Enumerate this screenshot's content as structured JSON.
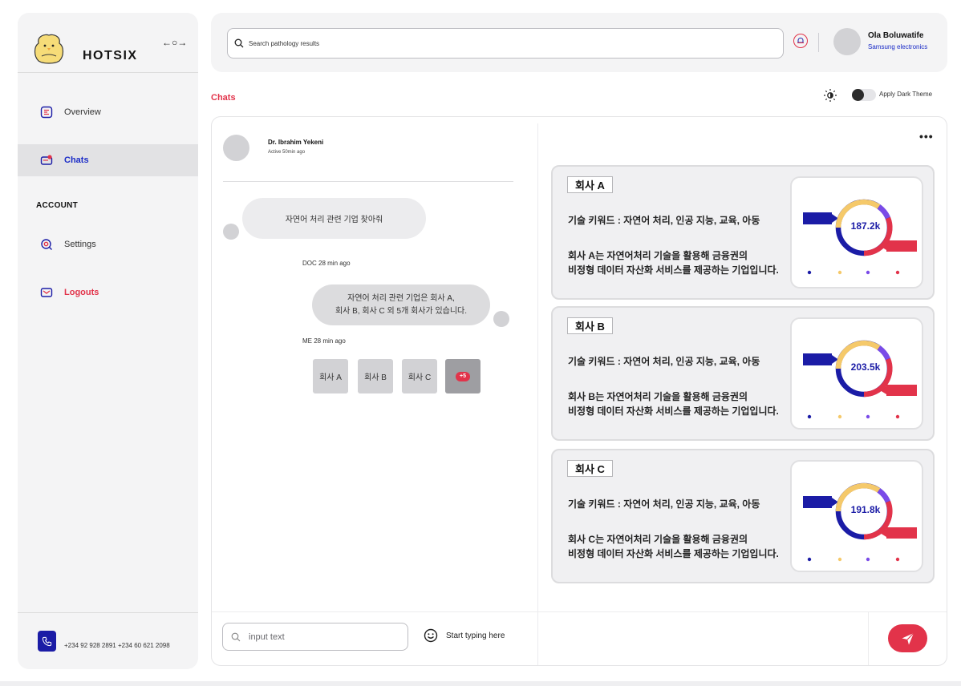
{
  "app": {
    "brand": "HOTSIX"
  },
  "sidebar": {
    "items": [
      {
        "label": "Overview"
      },
      {
        "label": "Chats"
      }
    ],
    "section_title": "ACCOUNT",
    "account_items": [
      {
        "label": "Settings"
      },
      {
        "label": "Logouts"
      }
    ],
    "contact_phones": "+234 92 928 2891  +234 60 621 2098"
  },
  "topbar": {
    "search_placeholder": "Search pathology results",
    "user_name": "Ola Boluwatife",
    "user_company": "Samsung electronics"
  },
  "page": {
    "title": "Chats",
    "dark_theme_label": "Apply Dark Theme",
    "dark_theme_on": false
  },
  "chat": {
    "contact_name": "Dr. Ibrahim Yekeni",
    "contact_status": "Active 50min ago",
    "messages": [
      {
        "text": "자연어 처리 관련 기업 찾아줘"
      },
      {
        "meta": "DOC   28 min ago",
        "lines": [
          "자연어 처리 관련 기업은 회사 A,",
          "회사 B, 회사 C 외 5개 회사가 있습니다."
        ]
      }
    ],
    "me_meta": "ME   28 min ago",
    "chips": [
      "회사 A",
      "회사 B",
      "회사 C"
    ],
    "more_badge": "+5",
    "input_placeholder": "input text",
    "typing_hint": "Start typing here"
  },
  "companies": [
    {
      "tag": "회사 A",
      "keywords": "기술 키워드 : 자연어 처리, 인공 지능, 교육, 아동",
      "desc_lines": [
        "회사 A는 자연어처리 기술을 활용해 금융권의",
        "비정형 데이터 자산화 서비스를 제공하는 기업입니다."
      ],
      "chart_value": "187.2k"
    },
    {
      "tag": "회사 B",
      "keywords": "기술 키워드 : 자연어 처리, 인공 지능, 교육, 아동",
      "desc_lines": [
        "회사 B는 자연어처리 기술을 활용해 금융권의",
        "비정형 데이터 자산화 서비스를 제공하는 기업입니다."
      ],
      "chart_value": "203.5k"
    },
    {
      "tag": "회사 C",
      "keywords": "기술 키워드 : 자연어 처리, 인공 지능, 교육, 아동",
      "desc_lines": [
        "회사 C는 자연어처리 기술을 활용해 금융권의",
        "비정형 데이터 자산화 서비스를 제공하는 기업입니다."
      ],
      "chart_value": "191.8k"
    }
  ],
  "colors": {
    "accent_red": "#e2334a",
    "accent_blue": "#1b1ca6",
    "donut_yellow": "#f5c96a",
    "donut_purple": "#7a4be8"
  },
  "icons": {
    "collapse": "collapse-expand-icon",
    "overview": "overview-icon",
    "chats": "chats-icon",
    "settings": "settings-icon",
    "logout": "logout-icon",
    "phone": "phone-icon",
    "search": "search-icon",
    "bell": "bell-icon",
    "sun": "sun-icon",
    "emoji": "emoji-icon",
    "send": "send-icon",
    "more": "more-options-icon"
  }
}
